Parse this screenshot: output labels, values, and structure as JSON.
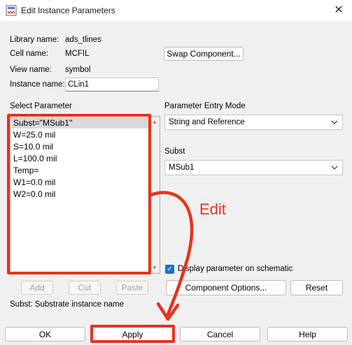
{
  "window": {
    "title": "Edit Instance Parameters",
    "close_glyph": "✕"
  },
  "info": {
    "library_label": "Library name:",
    "library_value": "ads_tlines",
    "cell_label": "Cell name:",
    "cell_value": "MCFIL",
    "view_label": "View name:",
    "view_value": "symbol",
    "instance_label": "Instance name:",
    "instance_value": "CLin1"
  },
  "swap_button": "Swap Component...",
  "select_parameter": {
    "label": "Select Parameter",
    "items": [
      "Subst=\"MSub1\"",
      "W=25.0 mil",
      "S=10.0 mil",
      "L=100.0 mil",
      "Temp=",
      "W1=0.0 mil",
      "W2=0.0 mil"
    ],
    "selected_index": 0
  },
  "entry_mode": {
    "label": "Parameter Entry Mode",
    "value": "String and Reference"
  },
  "subst": {
    "label": "Subst",
    "value": "MSub1"
  },
  "display_checkbox": {
    "label": "Display parameter on schematic",
    "checked": true
  },
  "edit_buttons": {
    "add": "Add",
    "cut": "Cut",
    "paste": "Paste"
  },
  "component_options_button": "Component Options...",
  "reset_button": "Reset",
  "status_text": "Subst: Substrate instance name",
  "footer": {
    "ok": "OK",
    "apply": "Apply",
    "cancel": "Cancel",
    "help": "Help"
  },
  "annotation": {
    "text": "Edit",
    "color": "#e8321c"
  },
  "icons": {
    "dropdown": "chevron-down-icon",
    "scroll_up": "scroll-up-arrow-icon",
    "scroll_down": "scroll-down-arrow-icon"
  }
}
